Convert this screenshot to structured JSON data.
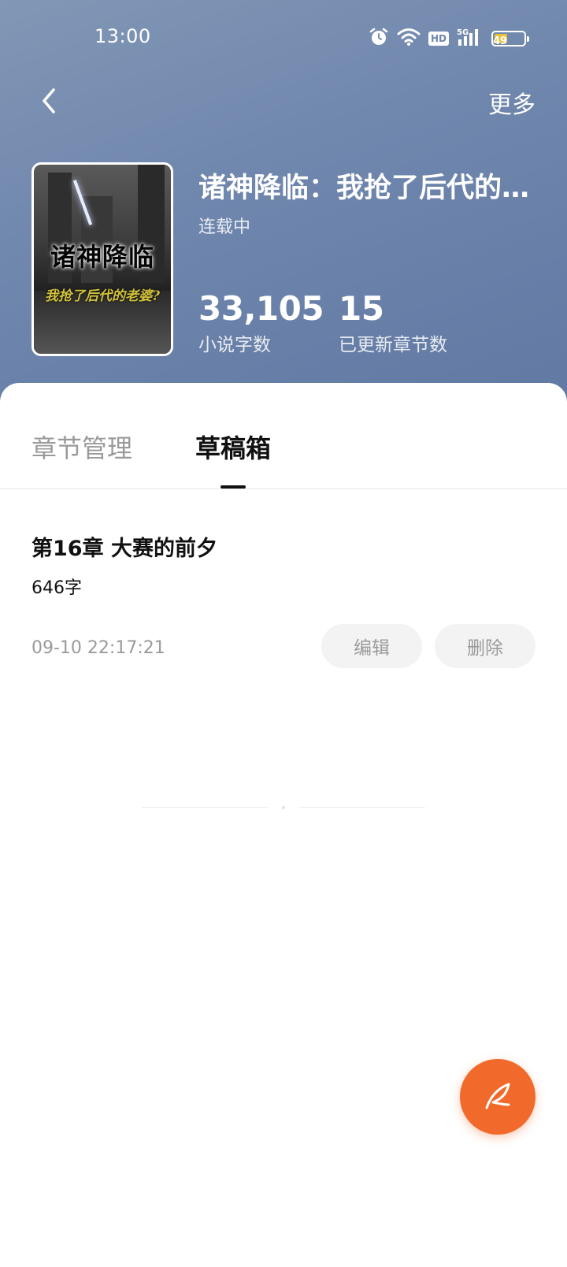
{
  "status_bar": {
    "time": "13:00",
    "network": "5G",
    "hd": "HD",
    "battery": "49",
    "battery_level": 0.49,
    "icons": [
      "alarm-icon",
      "wifi-icon",
      "hd-icon",
      "signal-5g-icon",
      "battery-icon"
    ]
  },
  "nav": {
    "back_icon": "chevron-left-icon",
    "more_label": "更多"
  },
  "book": {
    "cover_title": "诸神降临",
    "cover_subtitle": "我抢了后代的老婆?",
    "title": "诸神降临：我抢了后代的老婆",
    "status": "连载中",
    "word_count": "33,105",
    "word_count_label": "小说字数",
    "chapter_count": "15",
    "chapter_count_label": "已更新章节数"
  },
  "tabs": [
    {
      "label": "章节管理",
      "active": false
    },
    {
      "label": "草稿箱",
      "active": true
    }
  ],
  "drafts": [
    {
      "title": "第16章 大赛的前夕",
      "words": "646字",
      "time": "09-10 22:17:21",
      "edit_label": "编辑",
      "delete_label": "删除"
    }
  ],
  "fab": {
    "icon": "quill-pen-icon"
  },
  "colors": {
    "header_gradient": [
      "#8197b5",
      "#6179a3"
    ],
    "accent": "#f26a2b",
    "muted_text": "#9a9a9a",
    "pill_bg": "#f3f3f3"
  }
}
